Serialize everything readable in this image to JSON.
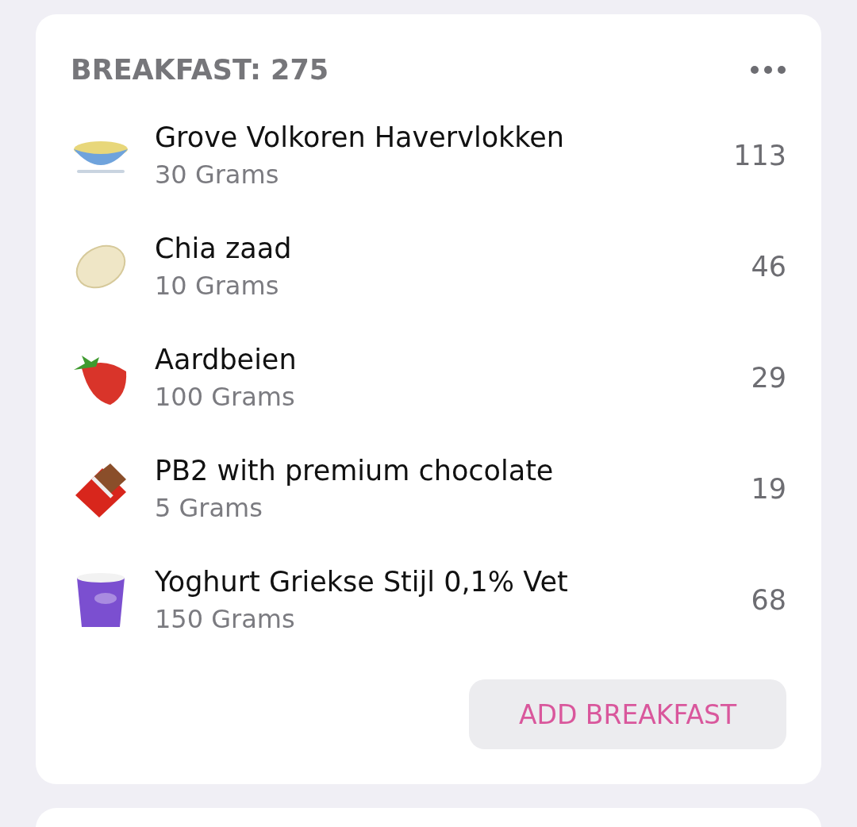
{
  "meal": {
    "title": "BREAKFAST: 275",
    "items": [
      {
        "name": "Grove Volkoren Havervlokken",
        "amount": "30 Grams",
        "calories": "113"
      },
      {
        "name": "Chia zaad",
        "amount": "10 Grams",
        "calories": "46"
      },
      {
        "name": "Aardbeien",
        "amount": "100 Grams",
        "calories": "29"
      },
      {
        "name": "PB2 with premium chocolate",
        "amount": "5 Grams",
        "calories": "19"
      },
      {
        "name": "Yoghurt Griekse Stijl 0,1% Vet",
        "amount": "150 Grams",
        "calories": "68"
      }
    ],
    "add_button": "ADD BREAKFAST"
  }
}
